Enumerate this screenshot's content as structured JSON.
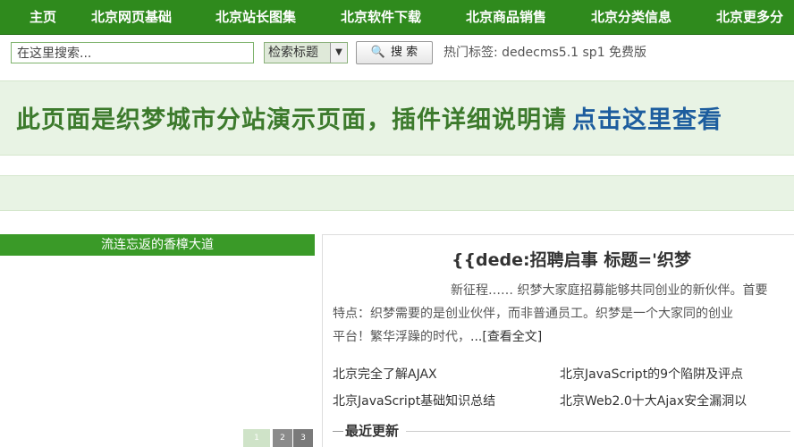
{
  "nav": {
    "items": [
      "主页",
      "北京网页基础",
      "北京站长图集",
      "北京软件下载",
      "北京商品销售",
      "北京分类信息",
      "北京更多分"
    ]
  },
  "search": {
    "placeholder": "在这里搜索...",
    "select_value": "检索标题",
    "button_label": "搜 索",
    "hot_label": "热门标签:",
    "hot_tags": "dedecms5.1 sp1 免费版"
  },
  "banner": {
    "text": "此页面是织梦城市分站演示页面，插件详细说明请",
    "link": "点击这里查看"
  },
  "left": {
    "header": "流连忘返的香樟大道",
    "pager": [
      "1",
      "2",
      "3"
    ]
  },
  "right": {
    "title": "{{dede:招聘启事 标题='织梦",
    "summary_line1": "新征程…… 织梦大家庭招募能够共同创业的新伙伴。首要",
    "summary_line2": "特点：织梦需要的是创业伙伴，而非普通员工。织梦是一个大家同的创业",
    "summary_line3": "平台！繁华浮躁的时代，",
    "more": "...[查看全文]",
    "links": [
      "北京完全了解AJAX",
      "北京JavaScript的9个陷阱及评点",
      "北京JavaScript基础知识总结",
      "北京Web2.0十大Ajax安全漏洞以"
    ],
    "recent_title": "最近更新"
  }
}
